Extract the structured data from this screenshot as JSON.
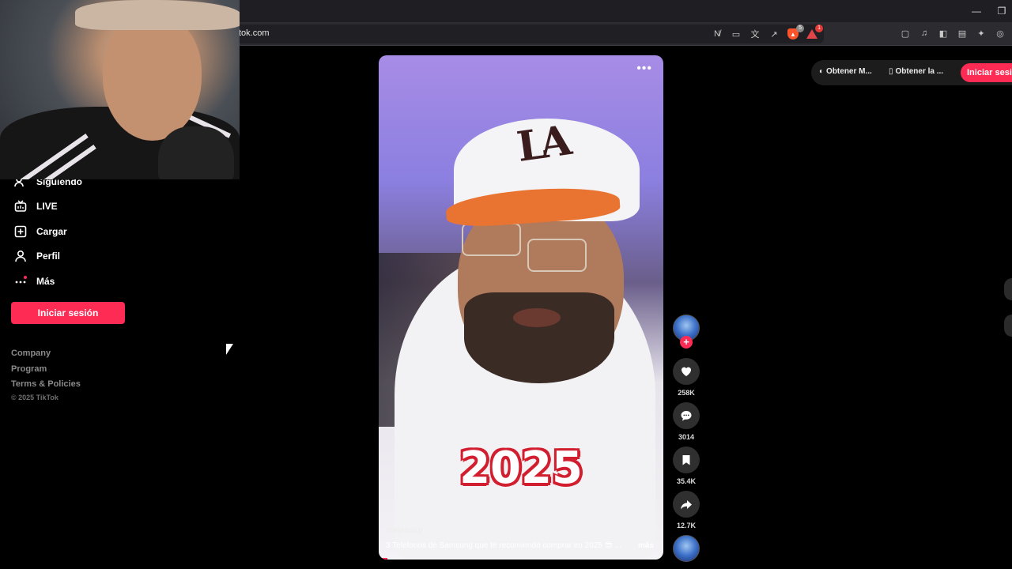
{
  "browser": {
    "url": "tok.com",
    "brave_badge": "5",
    "alert_badge": "1"
  },
  "sidebar": {
    "items": [
      {
        "label": "Siguiendo",
        "icon": "following-icon"
      },
      {
        "label": "LIVE",
        "icon": "live-icon"
      },
      {
        "label": "Cargar",
        "icon": "upload-icon"
      },
      {
        "label": "Perfil",
        "icon": "profile-icon"
      },
      {
        "label": "Más",
        "icon": "more-icon"
      }
    ],
    "login_label": "Iniciar sesión",
    "footer": [
      "Company",
      "Program",
      "Terms & Policies"
    ],
    "copyright": "© 2025 TikTok"
  },
  "video": {
    "overlay_text": "2025",
    "username": "thejesusp",
    "caption": "3 Telefonos de Samsung que te recomiendo comprar en 2025 😎 ...",
    "more_label": "más",
    "progress": 0.03
  },
  "actions": {
    "likes": "258K",
    "comments": "3014",
    "saves": "35.4K",
    "shares": "12.7K"
  },
  "topbar": {
    "get_app_1": "Obtener M...",
    "get_app_2": "Obtener la ...",
    "login_label": "Iniciar sesión"
  },
  "colors": {
    "accent": "#fe2c55",
    "background": "#000000"
  }
}
